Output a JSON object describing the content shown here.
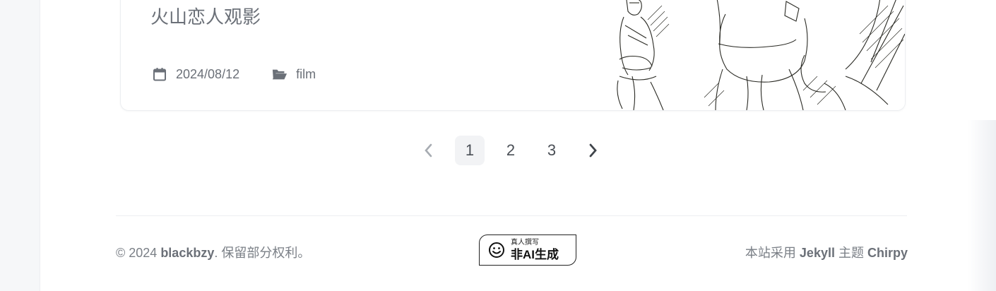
{
  "post": {
    "title": "火山恋人观影",
    "date": "2024/08/12",
    "category": "film",
    "icons": {
      "date": "calendar-icon",
      "category": "folder-open-icon"
    }
  },
  "pagination": {
    "prev_icon": "chevron-left-icon",
    "next_icon": "chevron-right-icon",
    "pages": [
      "1",
      "2",
      "3"
    ],
    "current": "1"
  },
  "footer": {
    "copyright_prefix": "© 2024 ",
    "owner": "blackbzy",
    "rights": ". 保留部分权利。",
    "theme_prefix": "本站采用 ",
    "jekyll": "Jekyll",
    "theme_mid": " 主题 ",
    "chirpy": "Chirpy",
    "badge": {
      "line1": "真人撰写",
      "line2": "非AI生成",
      "icon": "smiley-icon"
    }
  },
  "colors": {
    "text": "#6b7078",
    "active_page_bg": "#f2f3f5",
    "border": "#eceef1"
  }
}
